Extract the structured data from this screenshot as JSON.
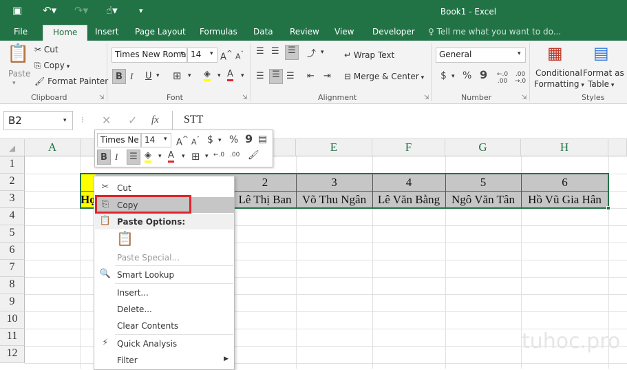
{
  "window": {
    "title": "Book1 - Excel"
  },
  "tabs": [
    "File",
    "Home",
    "Insert",
    "Page Layout",
    "Formulas",
    "Data",
    "Review",
    "View",
    "Developer"
  ],
  "tell_me": "Tell me what you want to do...",
  "ribbon": {
    "clipboard": {
      "paste": "Paste",
      "cut": "Cut",
      "copy": "Copy",
      "format_painter": "Format Painter",
      "label": "Clipboard"
    },
    "font": {
      "name": "Times New Roma",
      "size": "14",
      "label": "Font",
      "bold": "B",
      "italic": "I",
      "underline": "U"
    },
    "alignment": {
      "wrap": "Wrap Text",
      "merge": "Merge & Center",
      "label": "Alignment"
    },
    "number": {
      "format": "General",
      "currency": "$",
      "percent": "%",
      "comma": "9",
      "label": "Number"
    },
    "styles": {
      "conditional": "Conditional",
      "formatting": "Formatting",
      "format_as": "Format as",
      "table": "Table",
      "label": "Styles"
    }
  },
  "formula_bar": {
    "name_box": "B2",
    "fx": "fx",
    "content": "STT"
  },
  "columns": [
    "A",
    "E",
    "F",
    "G",
    "H"
  ],
  "rows": [
    "1",
    "2",
    "3",
    "4",
    "5",
    "6",
    "7",
    "8",
    "9",
    "10",
    "11",
    "12"
  ],
  "cells": {
    "row2": [
      "2",
      "3",
      "4",
      "5",
      "6"
    ],
    "row3_b": "Họ",
    "row3": [
      "Lê Thị Ban",
      "Võ Thu Ngân",
      "Lê Văn Bằng",
      "Ngô Văn Tân",
      "Hồ Vũ Gia Hân"
    ]
  },
  "mini_toolbar": {
    "font": "Times Ne",
    "size": "14",
    "currency": "$",
    "percent": "%",
    "comma": "9",
    "bold": "B",
    "italic": "I"
  },
  "context_menu": {
    "cut": "Cut",
    "copy": "Copy",
    "paste_options": "Paste Options:",
    "paste_special": "Paste Special...",
    "smart_lookup": "Smart Lookup",
    "insert": "Insert...",
    "delete": "Delete...",
    "clear": "Clear Contents",
    "quick_analysis": "Quick Analysis",
    "filter": "Filter"
  },
  "watermark": "tuhoc.pro",
  "colors": {
    "excel_green": "#217346",
    "highlight_yellow": "#ffff00",
    "red_box": "#e0242b"
  }
}
